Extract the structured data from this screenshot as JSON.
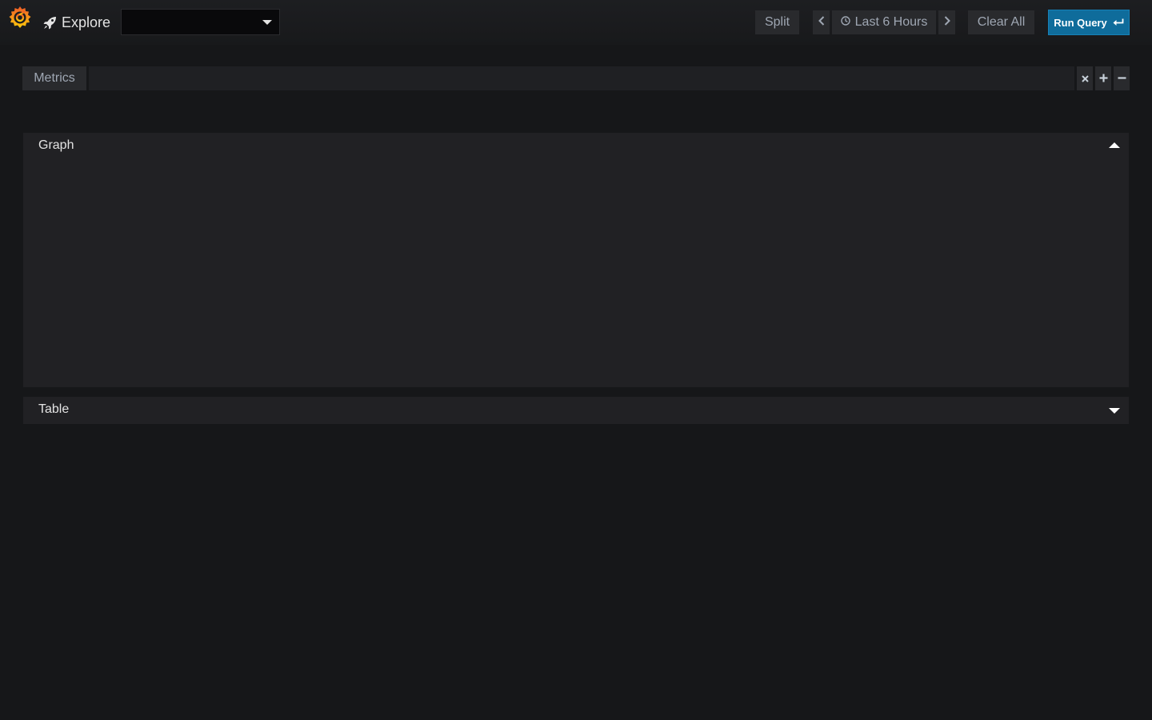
{
  "navbar": {
    "logo_icon": "grafana-logo-icon",
    "title": "Explore",
    "title_icon": "rocket-icon",
    "datasource": {
      "selected": "",
      "caret_icon": "caret-down-icon"
    },
    "split_label": "Split",
    "time_prev_icon": "chevron-left-icon",
    "time_range": {
      "icon": "clock-icon",
      "label": "Last 6 Hours"
    },
    "time_next_icon": "chevron-right-icon",
    "clear_all_label": "Clear All",
    "run_query": {
      "label": "Run Query",
      "icon": "enter-icon"
    }
  },
  "query_row": {
    "label": "Metrics",
    "value": "",
    "remove_icon": "close-icon",
    "add_icon": "plus-icon",
    "minus_icon": "minus-icon"
  },
  "panels": {
    "graph": {
      "title": "Graph",
      "expanded": true,
      "toggle_icon": "caret-up-icon"
    },
    "table": {
      "title": "Table",
      "expanded": false,
      "toggle_icon": "caret-down-icon"
    }
  },
  "colors": {
    "background": "#161719",
    "panel": "#212124",
    "button": "#292a2d",
    "primary": "#0f6c9b",
    "logo_orange": "#f05a28",
    "logo_yellow": "#fbca0a"
  }
}
